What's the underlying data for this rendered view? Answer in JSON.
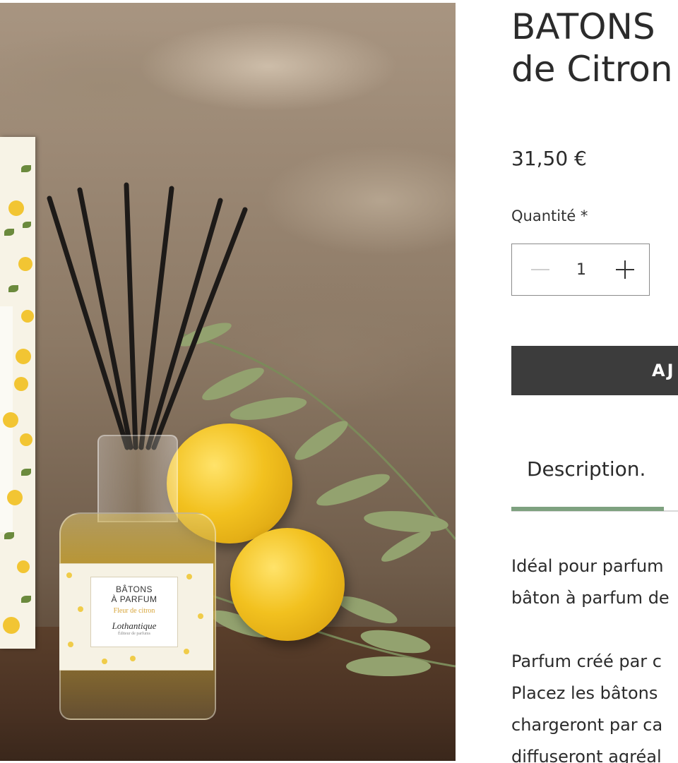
{
  "product": {
    "title_line1": "BATONS",
    "title_line2": "de Citron",
    "price": "31,50 €",
    "quantity_label": "Quantité *",
    "quantity_value": "1",
    "add_button_label": "AJ",
    "image": {
      "label_line1": "BÂTONS",
      "label_line2": "À PARFUM",
      "label_scent": "Fleur de citron",
      "label_brand": "Lothantique",
      "label_brand_sub": "Éditeur de parfums"
    }
  },
  "tabs": {
    "description_label": "Description."
  },
  "description": {
    "p1_line1": "Idéal pour parfum",
    "p1_line2": "bâton à parfum de",
    "p2_line1": "Parfum créé par c",
    "p2_line2": "Placez les bâtons",
    "p2_line3": "chargeront par ca",
    "p2_line4": "diffuseront agréal"
  },
  "colors": {
    "button_bg": "#3c3c3c",
    "tab_indicator": "#7ea17f",
    "text": "#2b2b2b"
  },
  "icons": {
    "minus": "minus-icon",
    "plus": "plus-icon"
  }
}
